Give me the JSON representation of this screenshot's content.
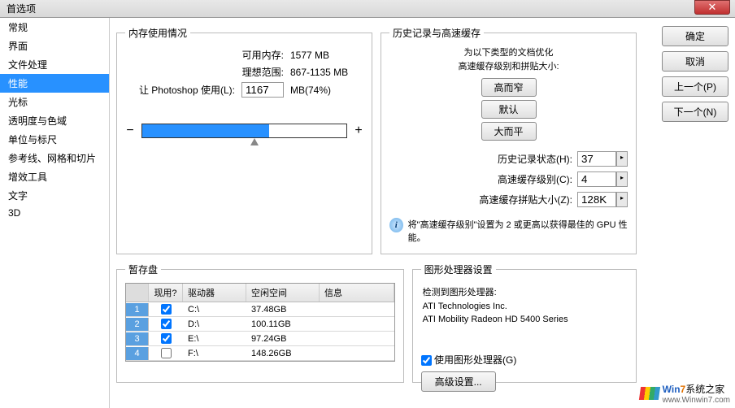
{
  "window": {
    "title": "首选项"
  },
  "sidebar": {
    "items": [
      "常规",
      "界面",
      "文件处理",
      "性能",
      "光标",
      "透明度与色域",
      "单位与标尺",
      "参考线、网格和切片",
      "增效工具",
      "文字",
      "3D"
    ],
    "selected_index": 3
  },
  "buttons": {
    "ok": "确定",
    "cancel": "取消",
    "prev": "上一个(P)",
    "next": "下一个(N)"
  },
  "memory": {
    "legend": "内存使用情况",
    "available_label": "可用内存:",
    "available_value": "1577 MB",
    "ideal_label": "理想范围:",
    "ideal_value": "867-1135 MB",
    "let_use_label": "让 Photoshop 使用(L):",
    "let_use_value": "1167",
    "let_use_suffix": "MB(74%)"
  },
  "cache": {
    "legend": "历史记录与高速缓存",
    "desc1": "为以下类型的文档优化",
    "desc2": "高速缓存级别和拼贴大小:",
    "btn_tall": "高而窄",
    "btn_default": "默认",
    "btn_wide": "大而平",
    "history_label": "历史记录状态(H):",
    "history_value": "37",
    "level_label": "高速缓存级别(C):",
    "level_value": "4",
    "tile_label": "高速缓存拼贴大小(Z):",
    "tile_value": "128K",
    "info": "将\"高速缓存级别\"设置为 2 或更高以获得最佳的 GPU 性能。"
  },
  "scratch": {
    "legend": "暂存盘",
    "col_active": "现用?",
    "col_drive": "驱动器",
    "col_free": "空闲空间",
    "col_info": "信息",
    "rows": [
      {
        "n": "1",
        "checked": true,
        "drive": "C:\\",
        "free": "37.48GB"
      },
      {
        "n": "2",
        "checked": true,
        "drive": "D:\\",
        "free": "100.11GB"
      },
      {
        "n": "3",
        "checked": true,
        "drive": "E:\\",
        "free": "97.24GB"
      },
      {
        "n": "4",
        "checked": false,
        "drive": "F:\\",
        "free": "148.26GB"
      }
    ]
  },
  "gpu": {
    "legend": "图形处理器设置",
    "detected_label": "检测到图形处理器:",
    "vendor": "ATI Technologies Inc.",
    "model": "ATI Mobility Radeon HD 5400 Series",
    "use_gpu_label": "使用图形处理器(G)",
    "advanced": "高级设置..."
  },
  "watermark": {
    "brand_w": "Win",
    "brand_7": "7",
    "brand_suffix": "系统之家",
    "site": "www.Winwin7.com"
  }
}
